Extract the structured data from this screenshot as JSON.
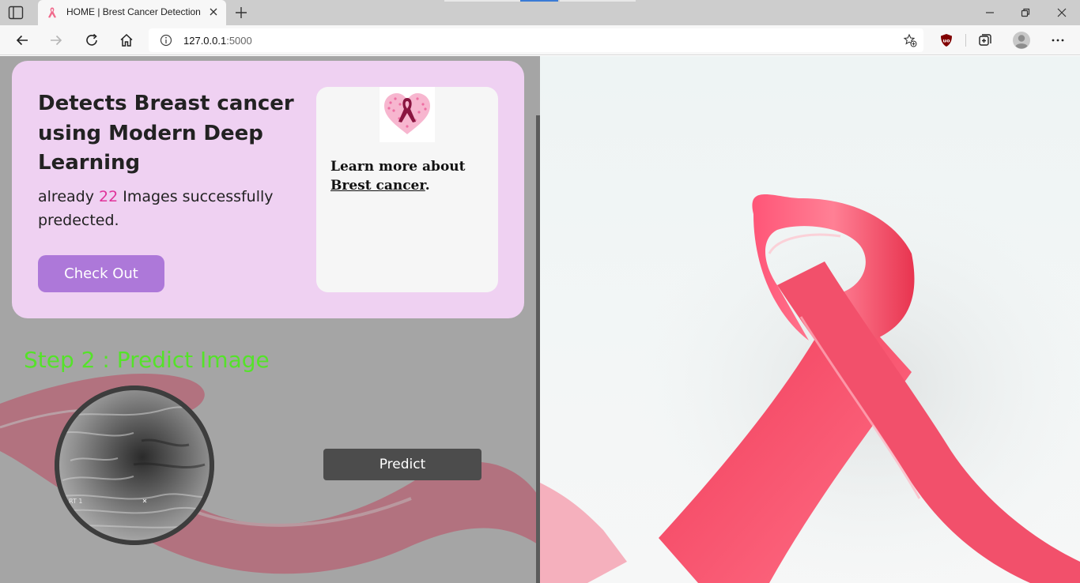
{
  "browser": {
    "tab_title": "HOME | Brest Cancer Detection",
    "url_host": "127.0.0.1",
    "url_port": ":5000"
  },
  "hero": {
    "title": "Detects Breast cancer using Modern Deep Learning",
    "stat_prefix": "already ",
    "stat_count": "22",
    "stat_suffix": " Images successfully predected.",
    "cta_label": "Check Out"
  },
  "info": {
    "text_prefix": "Learn more about ",
    "link_label": "Brest cancer",
    "text_suffix": "."
  },
  "predict_section": {
    "step_title": "Step 2 : Predict Image",
    "scan_label": "RT 1",
    "predict_label": "Predict"
  },
  "colors": {
    "hero_bg": "#efd1f2",
    "cta_bg": "#ad78d9",
    "count_accent": "#e0339a",
    "step_title": "#55e22a",
    "predict_bg": "#4c4c4c",
    "ribbon": "#f0426a"
  },
  "icons": [
    "tab-actions-icon",
    "ribbon-favicon-icon",
    "close-icon",
    "plus-icon",
    "minimize-icon",
    "restore-icon",
    "back-icon",
    "forward-icon",
    "refresh-icon",
    "home-icon",
    "info-icon",
    "favorite-add-icon",
    "ublock-icon",
    "collections-icon",
    "profile-icon",
    "more-icon",
    "ribbon-heart-logo"
  ]
}
